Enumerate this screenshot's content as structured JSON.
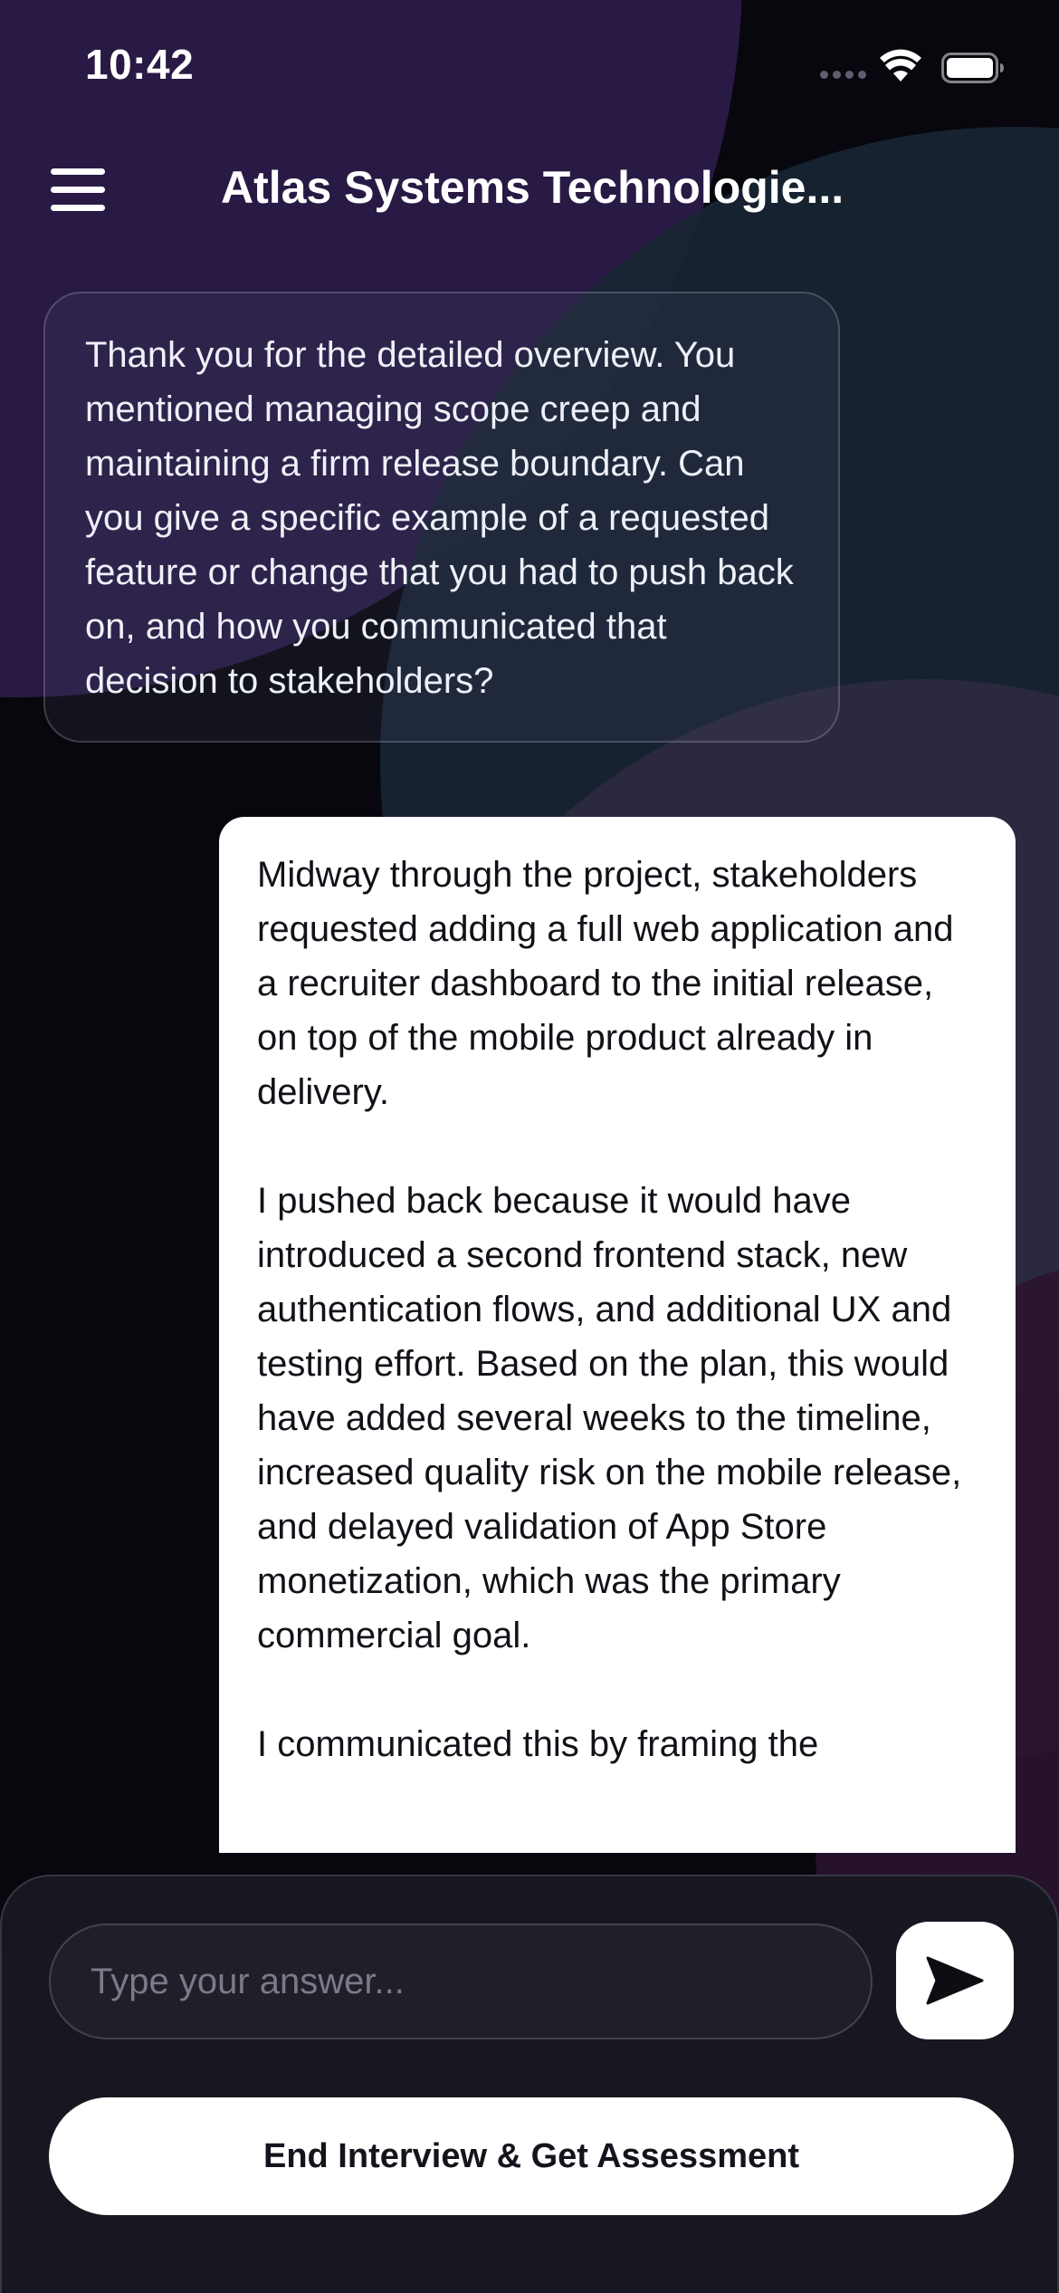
{
  "status_bar": {
    "time": "10:42"
  },
  "header": {
    "title": "Atlas Systems Technologie...",
    "menu_icon": "hamburger-menu-icon"
  },
  "messages": [
    {
      "role": "interviewer",
      "text": "Thank you for the detailed overview. You mentioned managing scope creep and maintaining a firm release boundary. Can you give a specific example of a requested feature or change that you had to push back on, and how you communicated that decision to stakeholders?"
    },
    {
      "role": "candidate",
      "text": "Midway through the project, stakeholders requested adding a full web application and a recruiter dashboard to the initial release, on top of the mobile product already in delivery.\n\nI pushed back because it would have introduced a second frontend stack, new authentication flows, and additional UX and testing effort. Based on the plan, this would have added several weeks to the timeline, increased quality risk on the mobile release, and delayed validation of App Store monetization, which was the primary commercial goal.\n\nI communicated this by framing the"
    }
  ],
  "composer": {
    "placeholder": "Type your answer...",
    "value": "",
    "send_icon": "send-arrow-icon",
    "end_button_label": "End Interview & Get Assessment"
  },
  "colors": {
    "background": "#07070d",
    "accent_purple": "#281a44",
    "panel": "#171721",
    "button": "#ffffff"
  }
}
